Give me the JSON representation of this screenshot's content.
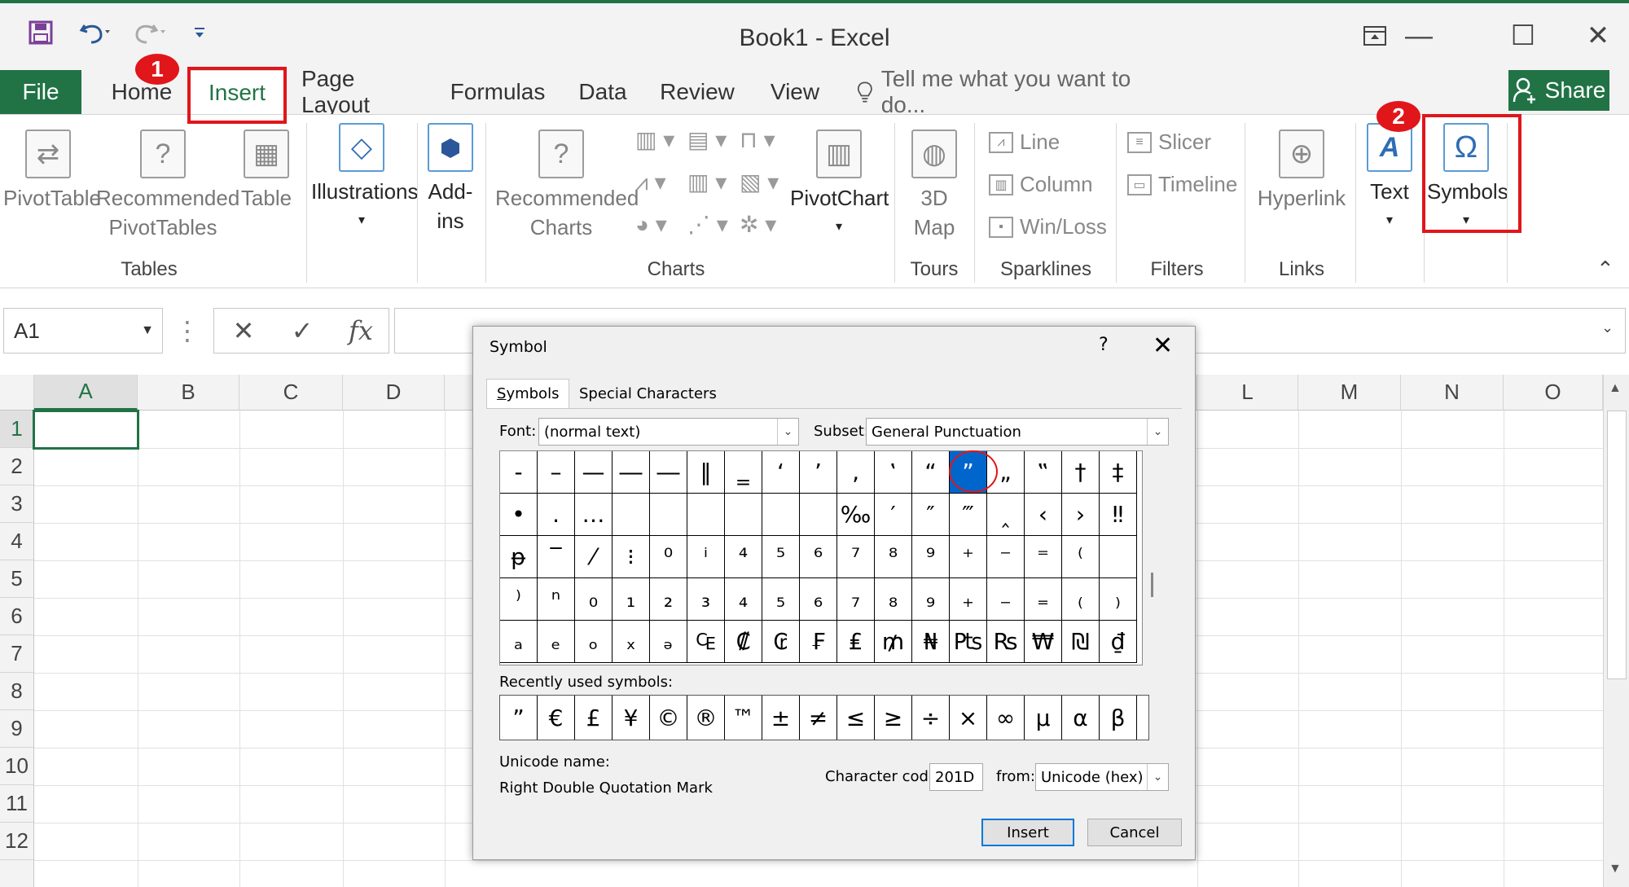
{
  "window": {
    "title": "Book1 - Excel",
    "qat": {
      "save_icon": "save-icon",
      "undo_icon": "undo-icon",
      "redo_icon": "redo-icon",
      "customize_icon": "customize-qat-icon"
    },
    "controls": {
      "ribbon_display": "⊡",
      "minimize": "—",
      "maximize": "☐",
      "close": "✕"
    }
  },
  "tabs": [
    "File",
    "Home",
    "Insert",
    "Page Layout",
    "Formulas",
    "Data",
    "Review",
    "View"
  ],
  "active_tab": "Insert",
  "tell_me": "Tell me what you want to do...",
  "share_label": "Share",
  "ribbon": {
    "tables": {
      "group": "Tables",
      "pivot": "PivotTable",
      "rec_pivot_1": "Recommended",
      "rec_pivot_2": "PivotTables",
      "table": "Table"
    },
    "illustrations": {
      "label": "Illustrations"
    },
    "addins": {
      "label_1": "Add-",
      "label_2": "ins"
    },
    "charts": {
      "group": "Charts",
      "rec_1": "Recommended",
      "rec_2": "Charts",
      "pivotchart": "PivotChart"
    },
    "tours": {
      "group": "Tours",
      "label_1": "3D",
      "label_2": "Map"
    },
    "sparklines": {
      "group": "Sparklines",
      "line": "Line",
      "column": "Column",
      "winloss": "Win/Loss"
    },
    "filters": {
      "group": "Filters",
      "slicer": "Slicer",
      "timeline": "Timeline"
    },
    "links": {
      "group": "Links",
      "hyperlink": "Hyperlink"
    },
    "text": {
      "label": "Text"
    },
    "symbols": {
      "label": "Symbols"
    }
  },
  "annotations": {
    "badge1": "1",
    "badge2": "2",
    "color": "#e0161b"
  },
  "formula_bar": {
    "name_box": "A1",
    "cancel": "✕",
    "enter": "✓",
    "fx": "fx",
    "formula": ""
  },
  "sheet": {
    "columns": [
      "A",
      "B",
      "C",
      "D",
      "L",
      "M",
      "N",
      "O"
    ],
    "rows": [
      "1",
      "2",
      "3",
      "4",
      "5",
      "6",
      "7",
      "8",
      "9",
      "10",
      "11",
      "12"
    ],
    "selected_cell": "A1"
  },
  "dialog": {
    "title": "Symbol",
    "help": "?",
    "close": "✕",
    "tabs": [
      "Symbols",
      "Special Characters"
    ],
    "font_label": "Font:",
    "font_value": "(normal text)",
    "subset_label": "Subset:",
    "subset_value": "General Punctuation",
    "symbol_rows": [
      [
        "‐",
        "–",
        "—",
        "―",
        "―",
        "‖",
        "‗",
        "‘",
        "’",
        "‚",
        "‛",
        "“",
        "”",
        "„",
        "‟",
        "†",
        "‡"
      ],
      [
        "•",
        "․",
        "…",
        "",
        "",
        "",
        "",
        "",
        "",
        "‰",
        "′",
        "″",
        "‴",
        "‸",
        "‹",
        "›",
        "‼"
      ],
      [
        "ᵽ",
        "‾",
        "⁄",
        "⁝",
        "⁰",
        "ⁱ",
        "⁴",
        "⁵",
        "⁶",
        "⁷",
        "⁸",
        "⁹",
        "⁺",
        "⁻",
        "⁼",
        "⁽",
        ""
      ],
      [
        "⁾",
        "ⁿ",
        "₀",
        "₁",
        "₂",
        "₃",
        "₄",
        "₅",
        "₆",
        "₇",
        "₈",
        "₉",
        "₊",
        "₋",
        "₌",
        "₍",
        "₎"
      ],
      [
        "ₐ",
        "ₑ",
        "ₒ",
        "ₓ",
        "ₔ",
        "₠",
        "₡",
        "₢",
        "₣",
        "₤",
        "₥",
        "₦",
        "₧",
        "₨",
        "₩",
        "₪",
        "₫"
      ]
    ],
    "selected_symbol": "”",
    "recent_label": "Recently used symbols:",
    "recent": [
      "”",
      "€",
      "£",
      "¥",
      "©",
      "®",
      "™",
      "±",
      "≠",
      "≤",
      "≥",
      "÷",
      "×",
      "∞",
      "µ",
      "α",
      "β"
    ],
    "unicode_name_label": "Unicode name:",
    "unicode_name": "Right Double Quotation Mark",
    "char_code_label": "Character code:",
    "char_code": "201D",
    "from_label": "from:",
    "from_value": "Unicode (hex)",
    "insert_label": "Insert",
    "cancel_label": "Cancel"
  }
}
